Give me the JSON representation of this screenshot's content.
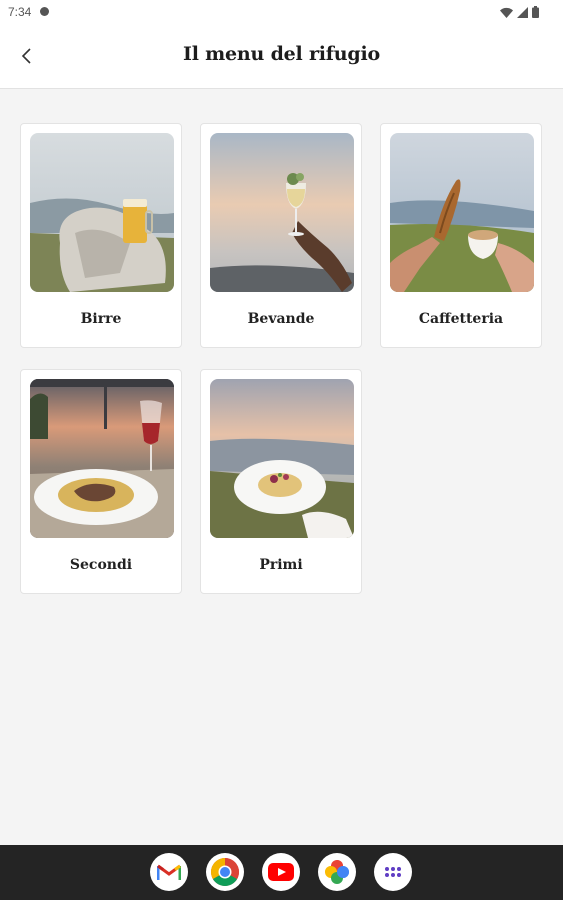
{
  "status_bar": {
    "time": "7:34"
  },
  "header": {
    "title": "Il menu del rifugio",
    "back_icon": "chevron-left-icon"
  },
  "menu_categories": [
    {
      "label": "Birre"
    },
    {
      "label": "Bevande"
    },
    {
      "label": "Caffetteria"
    },
    {
      "label": "Secondi"
    },
    {
      "label": "Primi"
    }
  ],
  "dock": {
    "apps": [
      "gmail-icon",
      "chrome-icon",
      "youtube-icon",
      "photos-icon",
      "app-drawer-icon"
    ]
  },
  "colors": {
    "background": "#f4f4f4",
    "card": "#ffffff",
    "navbar": "#242424"
  }
}
